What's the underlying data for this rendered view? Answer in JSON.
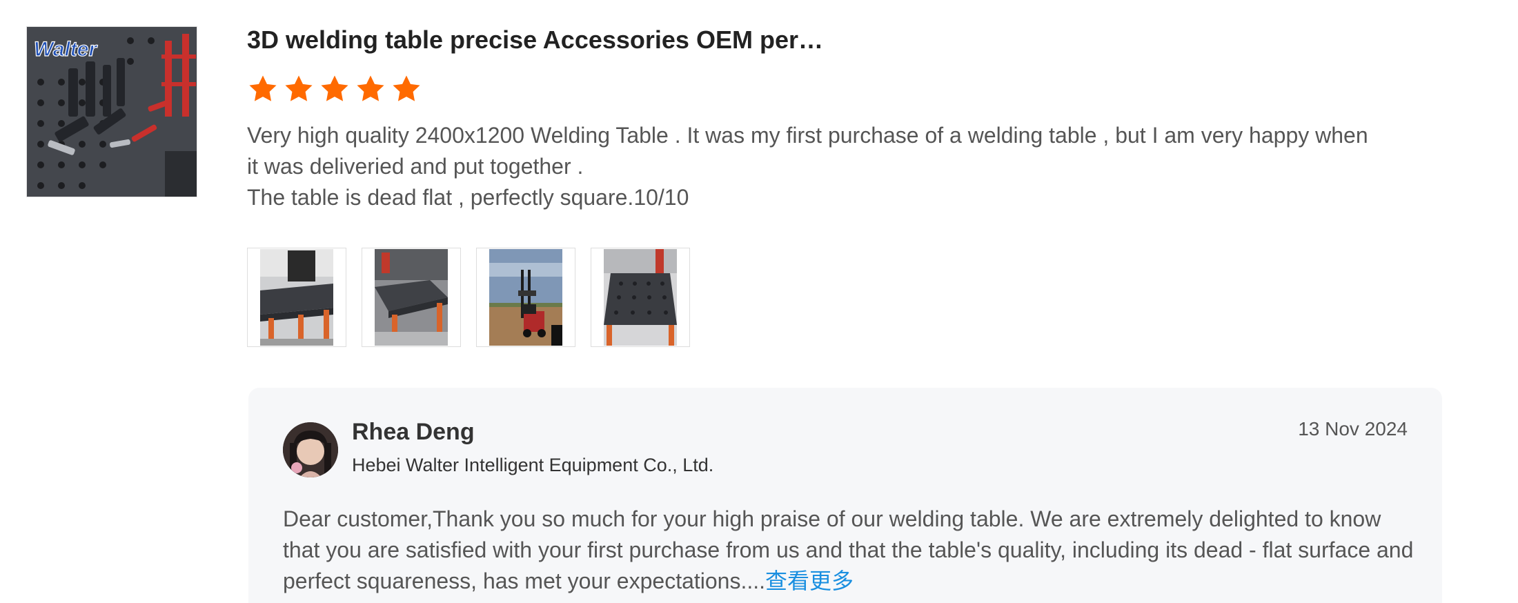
{
  "product": {
    "title": "3D welding table precise Accessories OEM per…",
    "thumbnail_logo_text": "Walter"
  },
  "review": {
    "rating": 5,
    "rating_max": 5,
    "star_color": "#ff6a00",
    "text_line1": "Very high quality 2400x1200 Welding Table . It was my first purchase of a welding table , but I am very happy when it was deliveried and put together .",
    "text_line2": "The table is dead flat , perfectly square.10/10",
    "images": [
      {
        "name": "review-image-1"
      },
      {
        "name": "review-image-2"
      },
      {
        "name": "review-image-3"
      },
      {
        "name": "review-image-4"
      }
    ]
  },
  "reply": {
    "name": "Rhea Deng",
    "company": "Hebei Walter Intelligent Equipment Co., Ltd.",
    "date": "13 Nov 2024",
    "text": "Dear customer,Thank you so much for your high praise of our welding table. We are extremely delighted to know that you are satisfied with your first purchase from us and that the table's quality, including its dead - flat surface and perfect squareness, has met your expectations....",
    "see_more": "查看更多",
    "link_color": "#1a8fe0"
  }
}
